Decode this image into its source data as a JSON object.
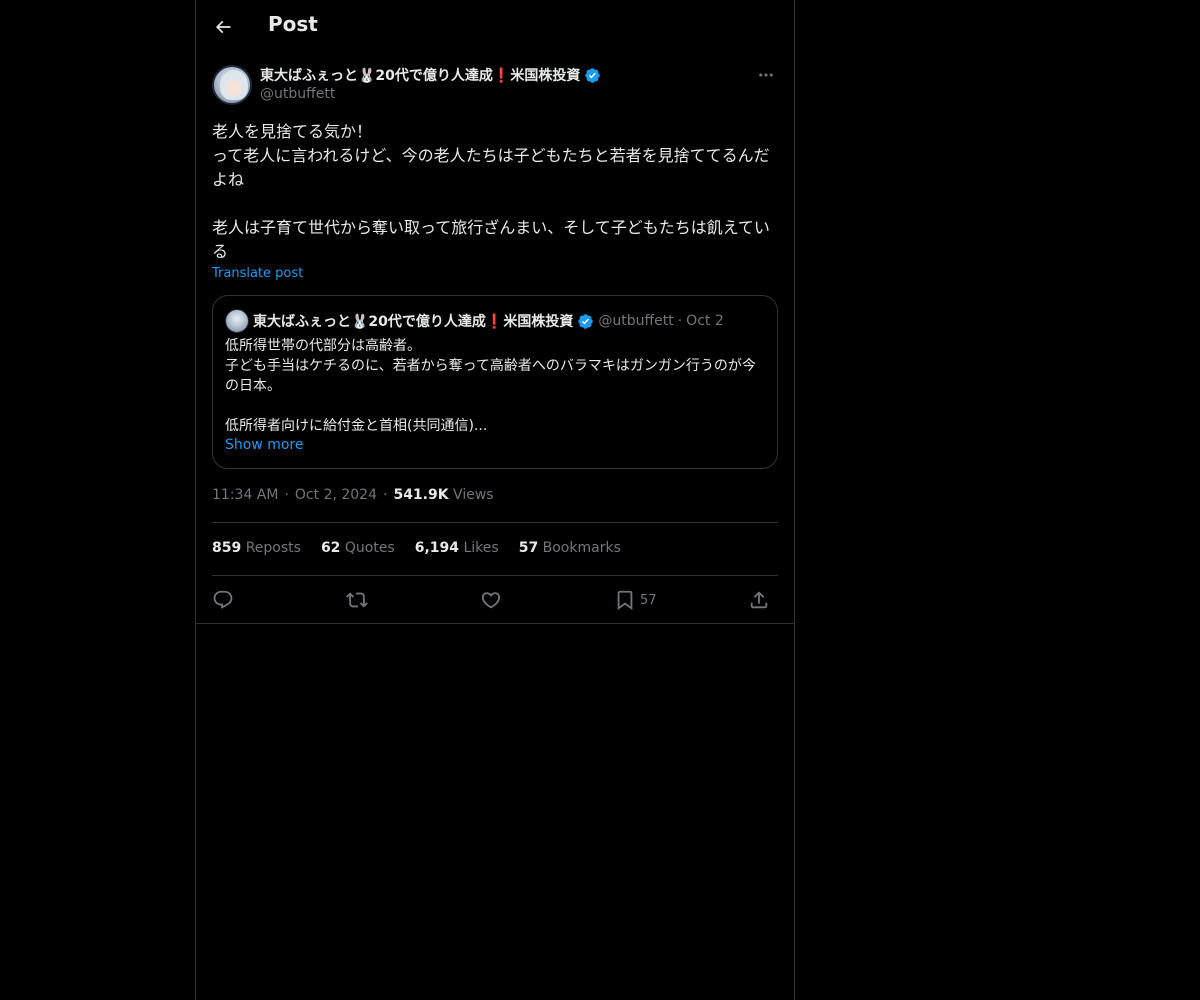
{
  "header": {
    "title": "Post"
  },
  "author": {
    "display_name": "東大ばふぇっと🐰20代で億り人達成❗米国株投資",
    "handle": "@utbuffett"
  },
  "post": {
    "text": "老人を見捨てる気か！\nって老人に言われるけど、今の老人たちは子どもたちと若者を見捨ててるんだよね\n\n老人は子育て世代から奪い取って旅行ざんまい、そして子どもたちは飢えている",
    "translate_label": "Translate post",
    "time": "11:34 AM",
    "date": "Oct 2, 2024",
    "views_count": "541.9K",
    "views_label": "Views"
  },
  "quote": {
    "display_name": "東大ばふぇっと🐰20代で億り人達成❗米国株投資",
    "handle": "@utbuffett",
    "date": "Oct 2",
    "text": "低所得世帯の代部分は高齢者。\n子ども手当はケチるのに、若者から奪って高齢者へのバラマキはガンガン行うのが今の日本。\n\n低所得者向けに給付金と首相(共同通信)...",
    "show_more": "Show more"
  },
  "stats": {
    "reposts_count": "859",
    "reposts_label": "Reposts",
    "quotes_count": "62",
    "quotes_label": "Quotes",
    "likes_count": "6,194",
    "likes_label": "Likes",
    "bookmarks_count": "57",
    "bookmarks_label": "Bookmarks"
  },
  "actions": {
    "bookmark_count": "57"
  },
  "colors": {
    "accent": "#1d9bf0",
    "background": "#000000",
    "border": "#2f3336",
    "muted": "#71767b",
    "text": "#e7e9ea"
  }
}
